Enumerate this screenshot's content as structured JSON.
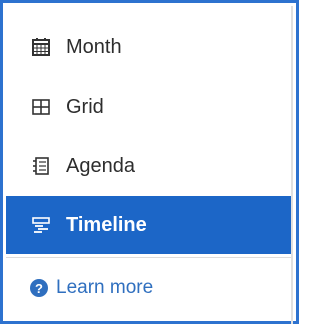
{
  "menu": {
    "items": [
      {
        "label": "Month",
        "icon": "calendar-icon",
        "selected": false
      },
      {
        "label": "Grid",
        "icon": "grid-icon",
        "selected": false
      },
      {
        "label": "Agenda",
        "icon": "list-icon",
        "selected": false
      },
      {
        "label": "Timeline",
        "icon": "timeline-icon",
        "selected": true
      }
    ],
    "learn_more": "Learn more"
  },
  "colors": {
    "frame_border": "#2d72cf",
    "selected_bg": "#1c66c7",
    "link": "#2f6fbf"
  }
}
